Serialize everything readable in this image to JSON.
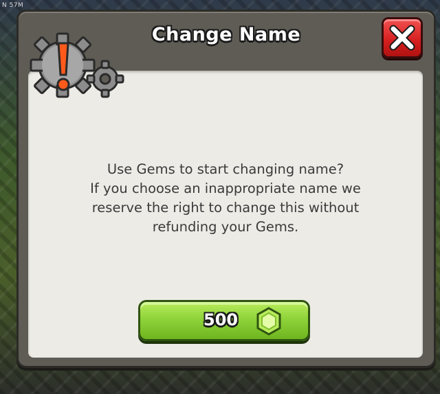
{
  "background": {
    "corner_text": "N 57M"
  },
  "dialog": {
    "title": "Change Name",
    "message_lines": [
      "Use Gems to start changing name?",
      "If you choose an inappropriate name we",
      "reserve the right to change this without",
      "refunding your Gems."
    ],
    "confirm_button": {
      "price": "500",
      "currency_icon": "gem-icon"
    },
    "close_icon": "close-icon",
    "header_icon": "gear-warning-icon"
  },
  "colors": {
    "close_red": "#d41e1e",
    "button_green": "#8fd33a",
    "gem_green": "#c6f07a",
    "warning_orange": "#ff5a1a"
  }
}
